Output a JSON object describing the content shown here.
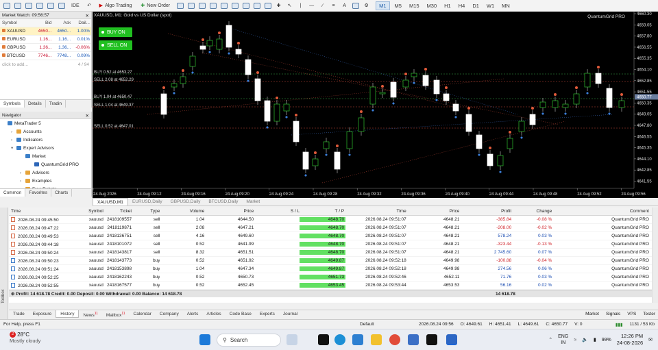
{
  "toolbar": {
    "ide": "IDE",
    "algo": "Algo Trading",
    "new_order": "New Order",
    "timeframes": [
      "M1",
      "M5",
      "M15",
      "M30",
      "H1",
      "H4",
      "D1",
      "W1",
      "MN"
    ]
  },
  "market_watch": {
    "title": "Market Watch: 09:56:57",
    "headers": [
      "Symbol",
      "Bid",
      "Ask",
      "Dail..."
    ],
    "rows": [
      {
        "symbol": "XAUUSD",
        "bid": "4650...",
        "ask": "4650...",
        "change": "1.00%"
      },
      {
        "symbol": "EURUSD",
        "bid": "1.16...",
        "ask": "1.16...",
        "change": "0.01%"
      },
      {
        "symbol": "GBPUSD",
        "bid": "1.36...",
        "ask": "1.36...",
        "change": "-0.06%"
      },
      {
        "symbol": "BTCUSD",
        "bid": "7746...",
        "ask": "7748...",
        "change": "0.09%"
      }
    ],
    "add_hint": "click to add...",
    "count": "4 / 94",
    "tabs": [
      "Symbols",
      "Details",
      "Tradin"
    ]
  },
  "navigator": {
    "title": "Navigator",
    "items": [
      {
        "label": "MetaTrader 5",
        "indent": 0
      },
      {
        "label": "Accounts",
        "indent": 1
      },
      {
        "label": "Indicators",
        "indent": 1
      },
      {
        "label": "Expert Advisors",
        "indent": 1
      },
      {
        "label": "Market",
        "indent": 2
      },
      {
        "label": "QuantumGrid PRO",
        "indent": 3
      },
      {
        "label": "Advisors",
        "indent": 2
      },
      {
        "label": "Examples",
        "indent": 2
      },
      {
        "label": "Free Robots",
        "indent": 2
      }
    ],
    "tabs": [
      "Common",
      "Favorites",
      "Charts"
    ]
  },
  "chart": {
    "title": "XAUUSD, M1:  Gold vs US Dollar (spot)",
    "ea_name": "QuantumGrid PRO",
    "buy_btn": "BUY ON",
    "sell_btn": "SELL ON",
    "price_labels": [
      "4660.30",
      "4659.05",
      "4657.80",
      "4656.55",
      "4655.35",
      "4654.10",
      "4652.85",
      "4651.55",
      "4650.35",
      "4649.05",
      "4647.80",
      "4646.55",
      "4645.35",
      "4644.10",
      "4642.85",
      "4641.55"
    ],
    "current_price": "4650.77",
    "time_labels": [
      "24 Aug 2026",
      "24 Aug 09:12",
      "24 Aug 09:16",
      "24 Aug 09:20",
      "24 Aug 09:24",
      "24 Aug 09:28",
      "24 Aug 09:32",
      "24 Aug 09:36",
      "24 Aug 09:40",
      "24 Aug 09:44",
      "24 Aug 09:48",
      "24 Aug 09:52",
      "24 Aug 09:56"
    ],
    "order_labels": [
      "BUY 0.52 at 4653.27",
      "SELL 2.08 at 4652.29",
      "BUY 1.04 at 4650.47",
      "SELL 1.04 at 4649.37",
      "SELL 0.52 at 4647.01"
    ],
    "tabs": [
      "XAUUSD,M1",
      "EURUSD,Daily",
      "GBPUSD,Daily",
      "BTCUSD,Daily",
      "Market"
    ]
  },
  "positions": {
    "headers": [
      "Time",
      "Symbol",
      "Ticket",
      "Type",
      "Volume",
      "Price",
      "S / L",
      "T / P",
      "Time",
      "Price",
      "Profit",
      "Change",
      "Comment"
    ],
    "rows": [
      [
        "2026.08.24 09:45:50",
        "xauusd",
        "2418109557",
        "sell",
        "1.04",
        "4644.50",
        "",
        "4648.70",
        "2026.08.24 09:51:07",
        "4648.21",
        "-385.84",
        "-0.08 %",
        "QuantumGrid PRO"
      ],
      [
        "2026.08.24 09:47:22",
        "xauusd",
        "2418119871",
        "sell",
        "2.08",
        "4647.21",
        "",
        "4648.70",
        "2026.08.24 09:51:07",
        "4648.21",
        "-208.00",
        "-0.02 %",
        "QuantumGrid PRO"
      ],
      [
        "2026.08.24 09:49:53",
        "xauusd",
        "2418136751",
        "sell",
        "4.16",
        "4649.60",
        "",
        "4648.70",
        "2026.08.24 09:51:07",
        "4648.21",
        "578.24",
        "0.03 %",
        "QuantumGrid PRO"
      ],
      [
        "2026.08.24 09:44:18",
        "xauusd",
        "2418101072",
        "sell",
        "0.52",
        "4641.99",
        "",
        "4648.70",
        "2026.08.24 09:51:07",
        "4648.21",
        "-323.44",
        "-0.13 %",
        "QuantumGrid PRO"
      ],
      [
        "2026.08.24 09:50:24",
        "xauusd",
        "2418143817",
        "sell",
        "8.32",
        "4651.51",
        "",
        "4648.70",
        "2026.08.24 09:51:07",
        "4648.21",
        "2 745.60",
        "0.07 %",
        "QuantumGrid PRO"
      ],
      [
        "2026.08.24 09:50:23",
        "xauusd",
        "2418143773",
        "buy",
        "0.52",
        "4651.92",
        "",
        "4649.87",
        "2026.08.24 09:52:18",
        "4649.98",
        "-100.88",
        "-0.04 %",
        "QuantumGrid PRO"
      ],
      [
        "2026.08.24 09:51:24",
        "xauusd",
        "2418153898",
        "buy",
        "1.04",
        "4647.34",
        "",
        "4649.87",
        "2026.08.24 09:52:18",
        "4649.98",
        "274.56",
        "0.06 %",
        "QuantumGrid PRO"
      ],
      [
        "2026.08.24 09:52:25",
        "xauusd",
        "2418162243",
        "buy",
        "0.52",
        "4650.73",
        "",
        "4651.73",
        "2026.08.24 09:52:46",
        "4652.11",
        "71.76",
        "0.03 %",
        "QuantumGrid PRO"
      ],
      [
        "2026.08.24 09:52:55",
        "xauusd",
        "2418167577",
        "buy",
        "0.52",
        "4652.45",
        "",
        "4653.45",
        "2026.08.24 09:53:44",
        "4653.53",
        "56.16",
        "0.02 %",
        "QuantumGrid PRO"
      ]
    ],
    "summary": "Profit: 14 618.78  Credit: 0.00  Deposit: 0.00  Withdrawal: 0.00  Balance: 14 618.78",
    "summary_total": "14 618.78"
  },
  "toolbox": {
    "label": "Toolbox",
    "tabs": [
      "Trade",
      "Exposure",
      "History",
      "News",
      "Mailbox",
      "Calendar",
      "Company",
      "Alerts",
      "Articles",
      "Code Base",
      "Experts",
      "Journal"
    ],
    "news_count": "11",
    "mail_count": "11",
    "right": [
      "Market",
      "Signals",
      "VPS",
      "Tester"
    ]
  },
  "status": {
    "help": "For Help, press F1",
    "profile": "Default",
    "datetime": "2026.08.24 09:56",
    "open": "O: 4649.61",
    "high": "H: 4651.41",
    "low": "L: 4649.61",
    "close": "C: 4650.77",
    "volume": "V: 0",
    "net": "1131 / 53 Kb"
  },
  "taskbar": {
    "temp": "28°C",
    "weather": "Mostly cloudy",
    "search": "Search",
    "lang1": "ENG",
    "lang2": "IN",
    "battery": "99%",
    "time": "12:26 PM",
    "date": "24-08-2026"
  }
}
